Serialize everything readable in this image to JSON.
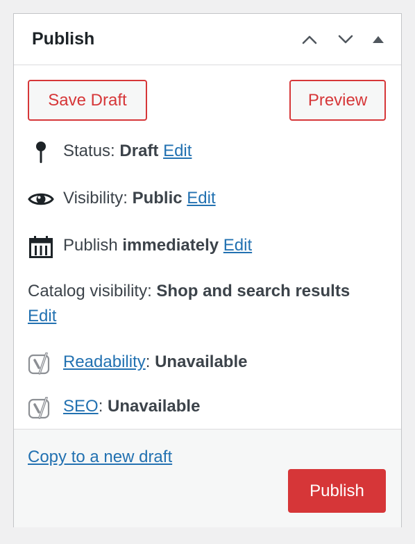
{
  "panel": {
    "title": "Publish",
    "header_controls": [
      "move-up",
      "move-down",
      "toggle-panel"
    ]
  },
  "actions": {
    "save_draft_label": "Save Draft",
    "preview_label": "Preview"
  },
  "status": {
    "label": "Status:",
    "value": "Draft",
    "edit": "Edit",
    "icon": "pin-icon"
  },
  "visibility": {
    "label": "Visibility:",
    "value": "Public",
    "edit": "Edit",
    "icon": "eye-icon"
  },
  "schedule": {
    "label": "Publish",
    "value": "immediately",
    "edit": "Edit",
    "icon": "calendar-icon"
  },
  "catalog": {
    "label": "Catalog visibility:",
    "value": "Shop and search results",
    "edit": "Edit"
  },
  "readability": {
    "link": "Readability",
    "separator": ":",
    "value": "Unavailable",
    "icon": "yoast-icon"
  },
  "seo": {
    "link": "SEO",
    "separator": ":",
    "value": "Unavailable",
    "icon": "yoast-icon"
  },
  "footer": {
    "copy_link": "Copy to a new draft",
    "publish_label": "Publish"
  },
  "colors": {
    "accent_red": "#d63638",
    "link_blue": "#2271b1",
    "text": "#3c434a"
  }
}
